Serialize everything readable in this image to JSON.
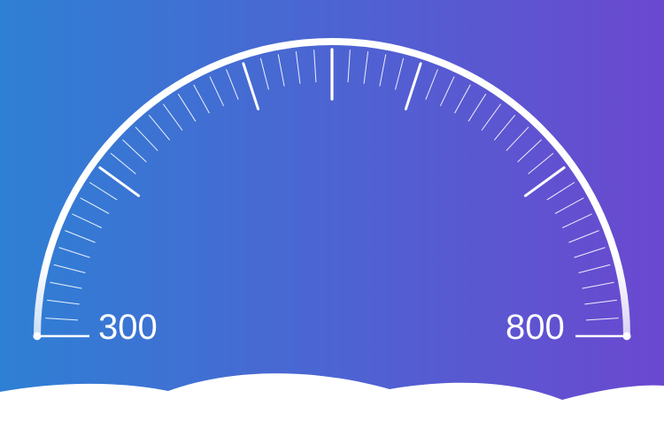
{
  "gauge": {
    "min_label": "300",
    "max_label": "800",
    "min_value": 300,
    "max_value": 800
  },
  "colors": {
    "gradient_start": "#2e80d4",
    "gradient_end": "#6b48d0",
    "gauge": "#ffffff",
    "clouds": "#ffffff"
  }
}
